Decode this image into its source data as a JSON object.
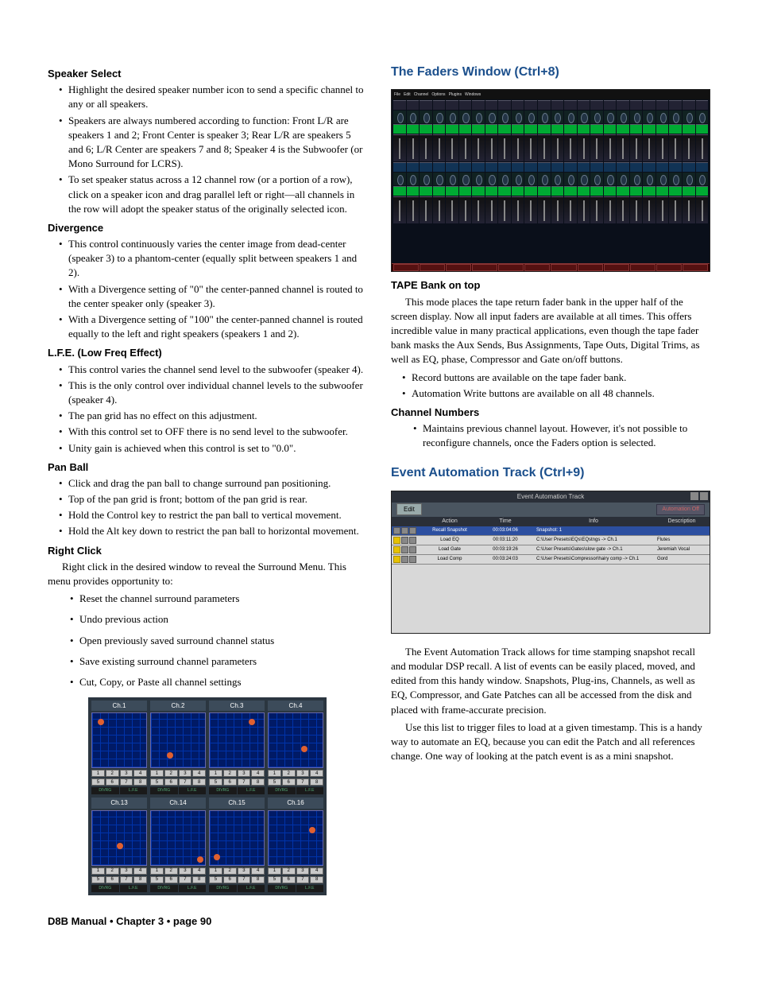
{
  "left": {
    "speaker_select": {
      "title": "Speaker Select",
      "b1": "Highlight the desired speaker number icon to send a specific channel to any or all speakers.",
      "b2": "Speakers are always numbered according to function: Front L/R are speakers 1 and 2; Front Center is speaker 3; Rear L/R are speakers 5 and 6; L/R Center are speakers 7 and 8; Speaker 4 is the Subwoofer (or Mono Surround for LCRS).",
      "b3": "To set speaker status across a 12 channel row (or a portion of a row), click on a speaker icon and drag parallel left or right—all channels in the row will adopt the speaker status of the originally selected icon."
    },
    "divergence": {
      "title": "Divergence",
      "b1": "This control continuously varies the center image from dead-center (speaker 3) to a phantom-center (equally split between speakers 1 and 2).",
      "b2": "With a Divergence setting of \"0\" the center-panned channel is routed to the center speaker only (speaker 3).",
      "b3": "With a Divergence setting of \"100\" the center-panned channel is routed equally to the left and right speakers (speakers 1 and 2)."
    },
    "lfe": {
      "title": "L.F.E. (Low Freq Effect)",
      "b1": "This control varies the channel send level to the subwoofer (speaker 4).",
      "b2": "This is the only control over individual channel levels to the subwoofer (speaker 4).",
      "b3": "The pan grid has no effect on this adjustment.",
      "b4": "With this control set to OFF there is no send level to the subwoofer.",
      "b5": "Unity gain is achieved when this control is set to \"0.0\"."
    },
    "panball": {
      "title": "Pan Ball",
      "b1": "Click and drag the pan ball to change surround pan positioning.",
      "b2": "Top of the pan grid is front; bottom of the pan grid is rear.",
      "b3": "Hold the Control key to restrict the pan ball to vertical movement.",
      "b4": "Hold the Alt key down to restrict the pan ball to horizontal movement."
    },
    "rightclick": {
      "title": "Right Click",
      "intro": "Right click in the desired window to reveal the Surround Menu. This menu provides opportunity to:",
      "b1": "Reset the channel surround parameters",
      "b2": "Undo previous action",
      "b3": "Open previously saved surround channel status",
      "b4": "Save existing surround channel parameters",
      "b5": "Cut, Copy, or Paste all channel settings"
    },
    "surround_labels": [
      "Ch.1",
      "Ch.2",
      "Ch.3",
      "Ch.4",
      "Ch.13",
      "Ch.14",
      "Ch.15",
      "Ch.16"
    ]
  },
  "right": {
    "faders_heading": "The Faders Window (Ctrl+8)",
    "tape": {
      "title": "TAPE Bank on top",
      "p1": "This mode places the tape return fader bank in the upper half of the screen display. Now all input faders are available at all times. This offers incredible value in many practical applications, even though the tape fader bank masks the Aux Sends, Bus Assignments, Tape Outs, Digital Trims, as well as EQ, phase, Compressor and Gate on/off buttons.",
      "b1": "Record buttons are available on the tape fader bank.",
      "b2": "Automation Write buttons are available on all 48 channels."
    },
    "chnum": {
      "title": "Channel Numbers",
      "b1": "Maintains previous channel layout. However, it's not possible to reconfigure channels, once the Faders option is selected."
    },
    "eat_heading": "Event Automation Track (Ctrl+9)",
    "eat_window": {
      "title": "Event Automation Track",
      "edit": "Edit",
      "auto": "Automation Off",
      "cols": {
        "action": "Action",
        "time": "Time",
        "info": "Info",
        "desc": "Description"
      },
      "rows": [
        {
          "action": "Recall Snapshot",
          "time": "00:03:04:06",
          "info": "Snapshot: 1",
          "desc": ""
        },
        {
          "action": "Load EQ",
          "time": "00:03:11:20",
          "info": "C:\\User Presets\\EQs\\EQstngs -> Ch.1",
          "desc": "Flutes"
        },
        {
          "action": "Load Gate",
          "time": "00:03:19:26",
          "info": "C:\\User Presets\\Gates\\slow gate -> Ch.1",
          "desc": "Jeremiah Vocal"
        },
        {
          "action": "Load Comp",
          "time": "00:03:24:03",
          "info": "C:\\User Presets\\Compressor\\hairy comp -> Ch.1",
          "desc": "Gord"
        }
      ]
    },
    "eat_p1": "The Event Automation Track allows for time stamping snapshot recall and modular DSP recall. A list of events can be easily placed, moved, and edited from this handy window. Snapshots, Plug-ins, Channels, as well as EQ, Compressor, and Gate Patches can all be accessed from the disk and placed with frame-accurate precision.",
    "eat_p2": "Use this list to trigger files to load at a given timestamp. This is a handy way to automate an EQ, because you can edit the Patch and all references change. One way of looking at the patch event is as a mini snapshot."
  },
  "footer": "D8B Manual • Chapter 3 • page  90"
}
